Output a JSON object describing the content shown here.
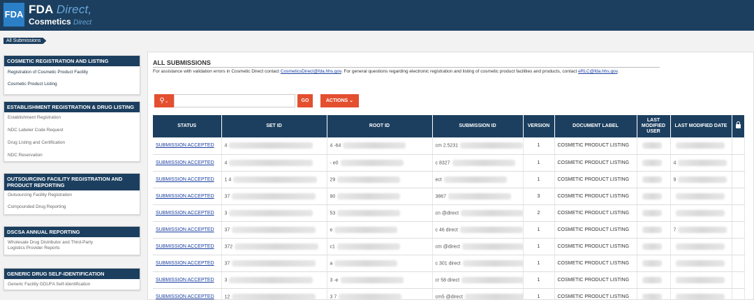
{
  "header": {
    "logo_text": "FDA",
    "brand_line1_main": "FDA",
    "brand_line1_accent": "Direct,",
    "brand_line2_main": "Cosmetics",
    "brand_line2_accent": "Direct",
    "brand_color": "#1c3f5f",
    "logo_color": "#2b7fc6"
  },
  "breadcrumb": "All Submissions",
  "sidebar": {
    "sections": [
      {
        "title": "COSMETIC REGISTRATION AND LISTING",
        "items": [
          "Registration of Cosmetic Product Facility",
          "Cosmetic Product Listing"
        ]
      },
      {
        "title": "ESTABLISHMENT REGISTRATION & DRUG LISTING",
        "items": [
          "Establishment Registration",
          "NDC Labeler Code Request",
          "Drug Listing and Certification",
          "NDC Reservation"
        ]
      },
      {
        "title": "OUTSOURCING FACILITY REGISTRATION AND PRODUCT REPORTING",
        "items": [
          "Outsourcing Facility Registration",
          "Compounded Drug Reporting"
        ]
      },
      {
        "title": "DSCSA ANNUAL REPORTING",
        "items": [
          "Wholesale Drug Distributor and Third-Party Logistics Provider Reports"
        ]
      },
      {
        "title": "GENERIC DRUG SELF-IDENTIFICATION",
        "items": [
          "Generic Facility GDUFA Self-Identification"
        ]
      }
    ]
  },
  "main": {
    "title": "ALL SUBMISSIONS",
    "info_part1": "For assistance with validation errors in Cosmetic Direct contact",
    "info_link1": "CosmeticsDirect@fda.hhs.gov",
    "info_part2": ". For general questions regarding electronic registration and listing of cosmetic product facilities and products, contact",
    "info_link2": "eRLC@fda.hhs.gov",
    "info_part3": ".",
    "go_label": "GO",
    "actions_label": "ACTIONS",
    "search_icon": "search-icon",
    "accent_color": "#e34f2f"
  },
  "table": {
    "headers": [
      "STATUS",
      "SET ID",
      "ROOT ID",
      "SUBMISSION ID",
      "VERSION",
      "DOCUMENT LABEL",
      "LAST MODIFIED USER",
      "LAST MODIFIED DATE",
      "lock-icon"
    ],
    "rows": [
      {
        "status": "SUBMISSION ACCEPTED",
        "set_id": "4",
        "root_id": "4 -64",
        "submission_id": "cm 2.5231",
        "version": "1",
        "label": "COSMETIC PRODUCT LISTING",
        "user": "",
        "date": ""
      },
      {
        "status": "SUBMISSION ACCEPTED",
        "set_id": "4",
        "root_id": "- e0",
        "submission_id": "c 8327",
        "version": "1",
        "label": "COSMETIC PRODUCT LISTING",
        "user": "",
        "date": "4"
      },
      {
        "status": "SUBMISSION ACCEPTED",
        "set_id": "1 4",
        "root_id": "29",
        "submission_id": "ect",
        "version": "1",
        "label": "COSMETIC PRODUCT LISTING",
        "user": "",
        "date": "9"
      },
      {
        "status": "SUBMISSION ACCEPTED",
        "set_id": "37",
        "root_id": "90",
        "submission_id": "3867",
        "version": "3",
        "label": "COSMETIC PRODUCT LISTING",
        "user": "",
        "date": ""
      },
      {
        "status": "SUBMISSION ACCEPTED",
        "set_id": "3",
        "root_id": "53",
        "submission_id": "cn @direct",
        "version": "2",
        "label": "COSMETIC PRODUCT LISTING",
        "user": "",
        "date": ""
      },
      {
        "status": "SUBMISSION ACCEPTED",
        "set_id": "37",
        "root_id": "e",
        "submission_id": "c 46 direct",
        "version": "1",
        "label": "COSMETIC PRODUCT LISTING",
        "user": "",
        "date": "7"
      },
      {
        "status": "SUBMISSION ACCEPTED",
        "set_id": "372",
        "root_id": "c1",
        "submission_id": "cm @direct",
        "version": "1",
        "label": "COSMETIC PRODUCT LISTING",
        "user": "",
        "date": ""
      },
      {
        "status": "SUBMISSION ACCEPTED",
        "set_id": "37",
        "root_id": "a",
        "submission_id": "c 301 direct",
        "version": "1",
        "label": "COSMETIC PRODUCT LISTING",
        "user": "",
        "date": ""
      },
      {
        "status": "SUBMISSION ACCEPTED",
        "set_id": "3",
        "root_id": "3 -e",
        "submission_id": "cr 58 direct",
        "version": "1",
        "label": "COSMETIC PRODUCT LISTING",
        "user": "",
        "date": ""
      },
      {
        "status": "SUBMISSION ACCEPTED",
        "set_id": "12",
        "root_id": "3 7",
        "submission_id": "cm5 @direct",
        "version": "1",
        "label": "COSMETIC PRODUCT LISTING",
        "user": "",
        "date": ""
      }
    ]
  }
}
